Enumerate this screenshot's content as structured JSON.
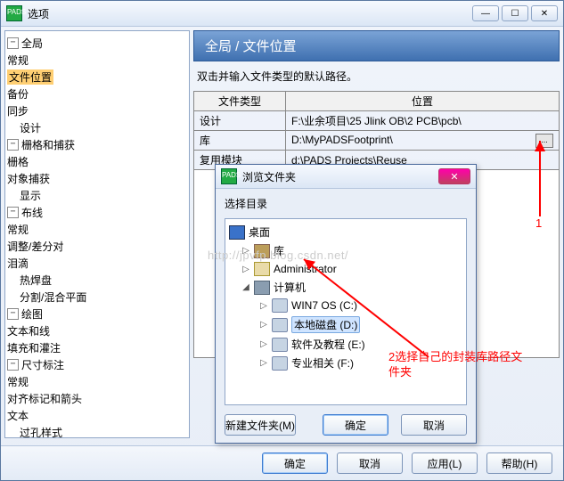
{
  "window": {
    "title": "选项",
    "icon_label": "PADS",
    "btn_min": "—",
    "btn_max": "☐",
    "btn_close": "✕"
  },
  "tree": {
    "n_global": "全局",
    "n_general1": "常规",
    "n_fileloc": "文件位置",
    "n_backup": "备份",
    "n_sync": "同步",
    "n_design": "设计",
    "n_grid_cap": "栅格和捕获",
    "n_grid": "栅格",
    "n_objsnap": "对象捕获",
    "n_display": "显示",
    "n_route": "布线",
    "n_general2": "常规",
    "n_tune": "调整/差分对",
    "n_teardrop": "泪滴",
    "n_thermal": "热焊盘",
    "n_split": "分割/混合平面",
    "n_draft": "绘图",
    "n_textline": "文本和线",
    "n_hatch": "填充和灌注",
    "n_dim": "尺寸标注",
    "n_general3": "常规",
    "n_align": "对齐标记和箭头",
    "n_text": "文本",
    "n_via": "过孔样式"
  },
  "main": {
    "banner": "全局 / 文件位置",
    "hint": "双击并输入文件类型的默认路径。",
    "col_type": "文件类型",
    "col_loc": "位置",
    "rows": [
      {
        "type": "设计",
        "loc": "F:\\业余项目\\25 Jlink OB\\2 PCB\\pcb\\"
      },
      {
        "type": "库",
        "loc": "D:\\MyPADSFootprint\\"
      },
      {
        "type": "复用模块",
        "loc": "d:\\PADS Projects\\Reuse"
      }
    ],
    "browse": "..."
  },
  "browse_dialog": {
    "title": "浏览文件夹",
    "subtitle": "选择目录",
    "items": {
      "desktop": "桌面",
      "library": "库",
      "admin": "Administrator",
      "computer": "计算机",
      "drive_c": "WIN7 OS (C:)",
      "drive_d": "本地磁盘 (D:)",
      "drive_e": "软件及教程 (E:)",
      "drive_f": "专业相关 (F:)"
    },
    "btn_new": "新建文件夹(M)",
    "btn_ok": "确定",
    "btn_cancel": "取消"
  },
  "bottom": {
    "ok": "确定",
    "cancel": "取消",
    "apply": "应用(L)",
    "help": "帮助(H)"
  },
  "annotations": {
    "a1": "1",
    "a2": "2选择自己的封装库路径文\n件夹"
  },
  "watermark": "http://jpvfp.blog.csdn.net/"
}
